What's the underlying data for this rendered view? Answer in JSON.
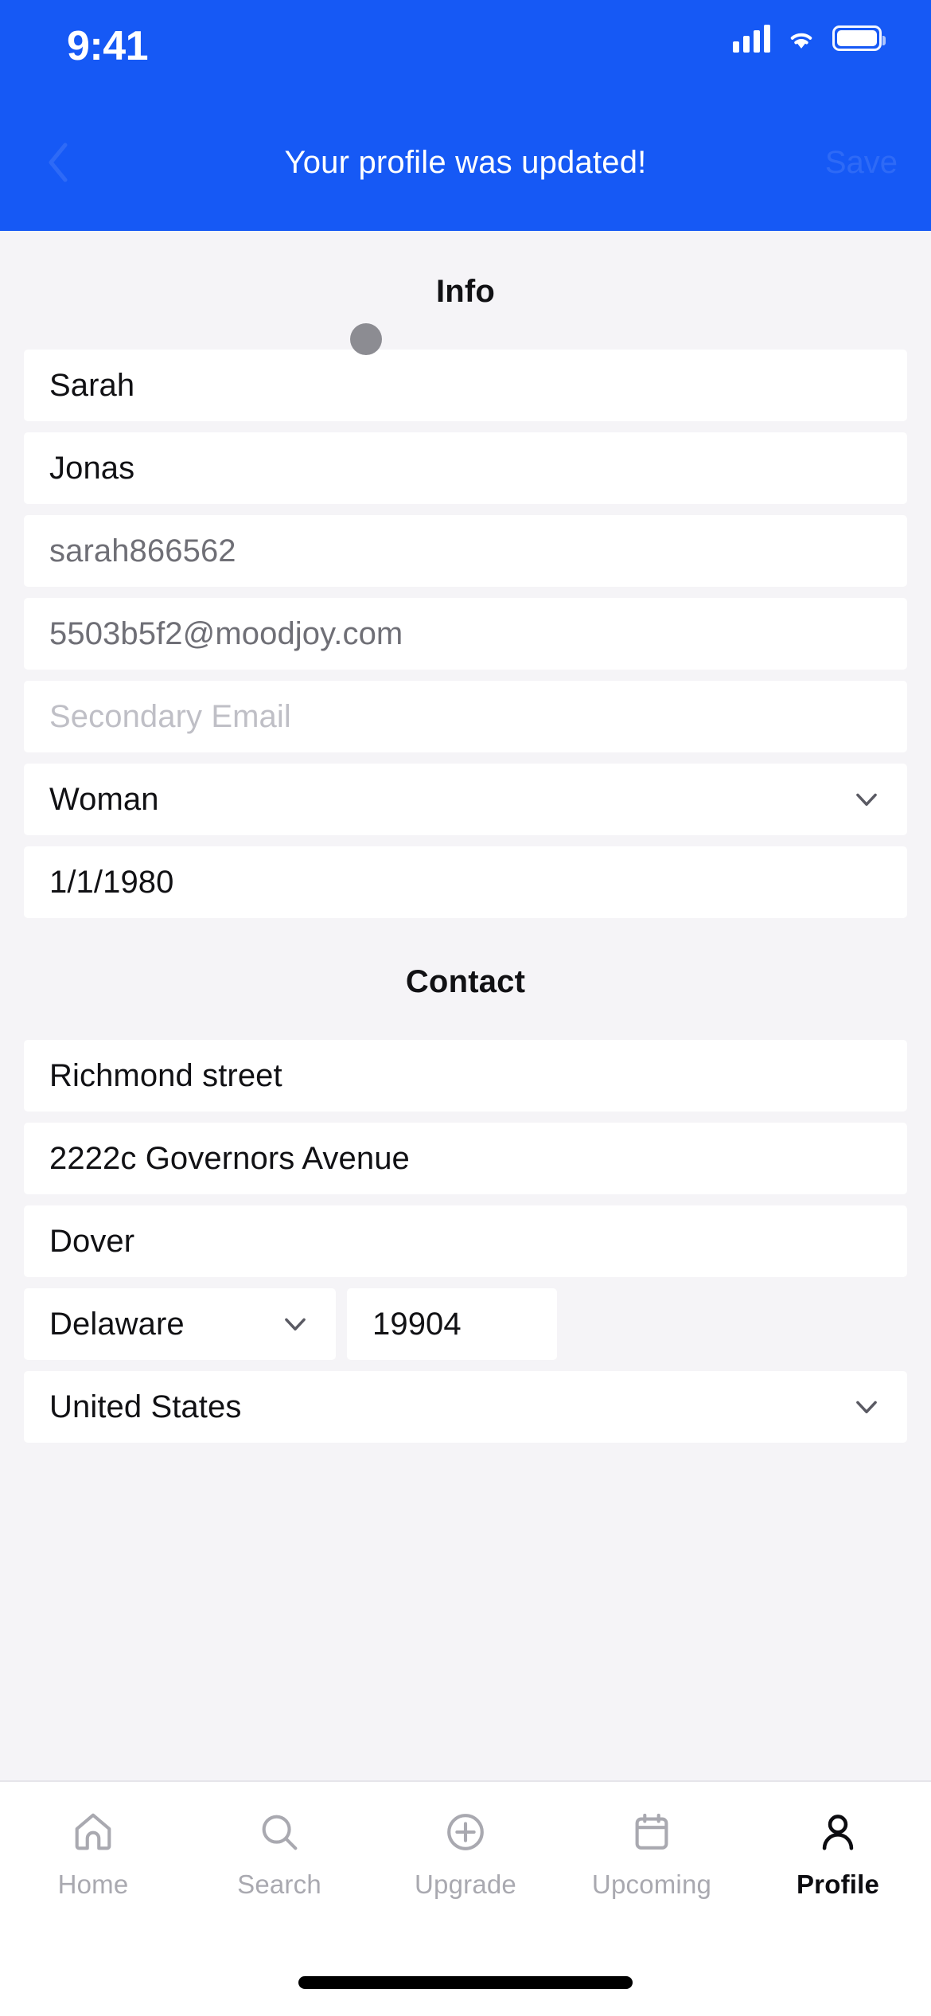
{
  "status_bar": {
    "time": "9:41",
    "cellular_icon": "cellular-signal-icon",
    "wifi_icon": "wifi-icon",
    "battery_icon": "battery-full-icon"
  },
  "header": {
    "background_color": "#1659F5",
    "back_label": "back-chevron-icon",
    "save_label": "Save",
    "toast_message": "Your profile was updated!"
  },
  "sections": {
    "info": {
      "title": "Info",
      "fields": [
        {
          "name": "first-name",
          "value": "Sarah",
          "style": "normal",
          "control": "text"
        },
        {
          "name": "last-name",
          "value": "Jonas",
          "style": "normal",
          "control": "text"
        },
        {
          "name": "username",
          "value": "sarah866562",
          "style": "muted",
          "control": "text"
        },
        {
          "name": "email",
          "value": "5503b5f2@moodjoy.com",
          "style": "muted",
          "control": "text"
        },
        {
          "name": "secondary-email",
          "value": "Secondary Email",
          "style": "placeholder",
          "control": "text"
        },
        {
          "name": "gender",
          "value": "Woman",
          "style": "normal",
          "control": "select"
        },
        {
          "name": "birthdate",
          "value": "1/1/1980",
          "style": "normal",
          "control": "text"
        }
      ]
    },
    "contact": {
      "title": "Contact",
      "fields": [
        {
          "name": "address-line-1",
          "value": "Richmond street",
          "style": "normal",
          "control": "text"
        },
        {
          "name": "address-line-2",
          "value": "2222c Governors Avenue",
          "style": "normal",
          "control": "text"
        },
        {
          "name": "city",
          "value": "Dover",
          "style": "normal",
          "control": "text"
        },
        {
          "name": "state",
          "value": "Delaware",
          "style": "normal",
          "control": "select"
        },
        {
          "name": "zip",
          "value": "19904",
          "style": "normal",
          "control": "text"
        },
        {
          "name": "country",
          "value": "United States",
          "style": "normal",
          "control": "select"
        }
      ]
    }
  },
  "tabbar": {
    "items": [
      {
        "label": "Home",
        "icon": "home-icon",
        "active": false
      },
      {
        "label": "Search",
        "icon": "search-icon",
        "active": false
      },
      {
        "label": "Upgrade",
        "icon": "plus-circle-icon",
        "active": false
      },
      {
        "label": "Upcoming",
        "icon": "calendar-icon",
        "active": false
      },
      {
        "label": "Profile",
        "icon": "person-icon",
        "active": true
      }
    ],
    "active_color": "#0C0C10",
    "inactive_color": "#A9A9B0"
  },
  "cursor": {
    "name": "touch-cursor-dot",
    "color": "#8C8C92"
  }
}
